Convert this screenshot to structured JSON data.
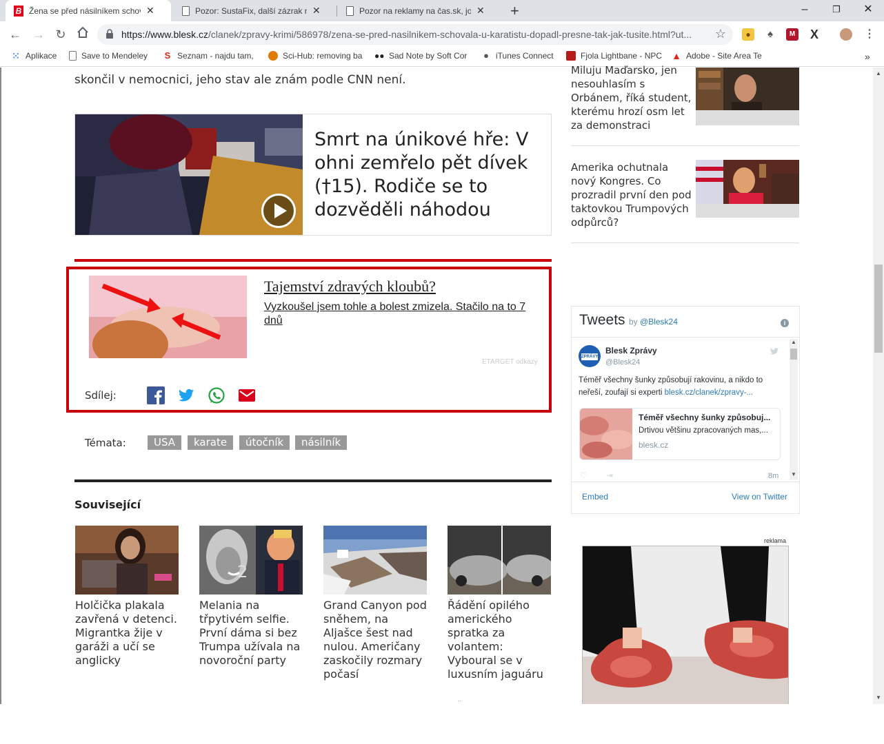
{
  "browser": {
    "tabs": [
      {
        "title": "Žena se před násilníkem schovala u karatistu",
        "active": true
      },
      {
        "title": "Pozor: SustaFix, další zázrak na bolest",
        "active": false
      },
      {
        "title": "Pozor na reklamy na čas.sk, jointflex",
        "active": false
      }
    ],
    "url_host": "https://www.blesk.cz",
    "url_path": "/clanek/zpravy-krimi/586978/zena-se-pred-nasilnikem-schovala-u-karatistu-dopadl-presne-tak-jak-tusite.html?ut...",
    "bookmarks": [
      {
        "label": "Aplikace",
        "icon": "apps-grid-icon",
        "color": "#4285f4"
      },
      {
        "label": "Save to Mendeley",
        "icon": "document-icon",
        "color": "#5f6368"
      },
      {
        "label": "Seznam - najdu tam,",
        "icon": "seznam-s-icon",
        "color": "#d52b1e"
      },
      {
        "label": "Sci-Hub: removing ba",
        "icon": "scihub-icon",
        "color": "#e07b00"
      },
      {
        "label": "Sad Note by Soft Cor",
        "icon": "people-icon",
        "color": "#222"
      },
      {
        "label": "iTunes Connect",
        "icon": "apple-icon",
        "color": "#555"
      },
      {
        "label": "Fjola Lightbane - NPC",
        "icon": "dnd-icon",
        "color": "#b71c1c"
      },
      {
        "label": "Adobe - Site Area Te",
        "icon": "adobe-icon",
        "color": "#e1251b"
      }
    ],
    "more_bookmarks": "»"
  },
  "article": {
    "intro_tail": "skončil v nemocnici, jeho stav ale znám podle CNN není.",
    "featured": {
      "title": "Smrt na únikové hře: V ohni zemřelo pět dívek (†15). Rodiče se to dozvěděli náhodou",
      "has_video": true
    },
    "sponsored": {
      "title": "Tajemství zdravých kloubů?",
      "description": "Vyzkoušel jsem tohle a bolest zmizela. Stačilo na to 7 dnů",
      "source": "ETARGET odkazy"
    },
    "share_label": "Sdílej:",
    "share_icons": [
      "facebook-icon",
      "twitter-icon",
      "whatsapp-icon",
      "email-icon"
    ],
    "tags_label": "Témata:",
    "tags": [
      "USA",
      "karate",
      "útočník",
      "násilník"
    ],
    "related_heading": "Související",
    "related": [
      {
        "text": "Holčička plakala zavřená v detenci. Migrantka žije v garáži a učí se anglicky"
      },
      {
        "text": "Melania na třpytivém selfie. První dáma si bez Trumpa užívala na novoroční party"
      },
      {
        "text": "Grand Canyon pod sněhem, na Aljašce šest nad nulou. Američany zaskočily rozmary počasí"
      },
      {
        "text": "Řádění opilého amerického spratka za volantem: Vyboural se v luxusním jaguáru"
      }
    ]
  },
  "sidebar": {
    "stories": [
      {
        "text": "Miluju Maďarsko, jen nesouhlasím s Orbánem, říká student, kterému hrozí osm let za demonstraci"
      },
      {
        "text": "Amerika ochutnala nový Kongres. Co prozradil první den pod taktovkou Trumpových odpůrců?"
      }
    ],
    "tweets": {
      "heading": "Tweets",
      "by": "by",
      "handle_link": "@Blesk24",
      "author_name": "Blesk Zprávy",
      "author_handle": "@Blesk24",
      "text": "Téměř všechny šunky způsobují rakovinu, a nikdo to neřeší, zoufají si experti",
      "link": "blesk.cz/clanek/zpravy-...",
      "card_title": "Téměř všechny šunky způsobuj...",
      "card_desc": "Drtivou většinu zpracovaných mas,...",
      "card_domain": "blesk.cz",
      "time": "8m",
      "embed": "Embed",
      "view_on_twitter": "View on Twitter"
    },
    "ad_label": "reklama"
  }
}
